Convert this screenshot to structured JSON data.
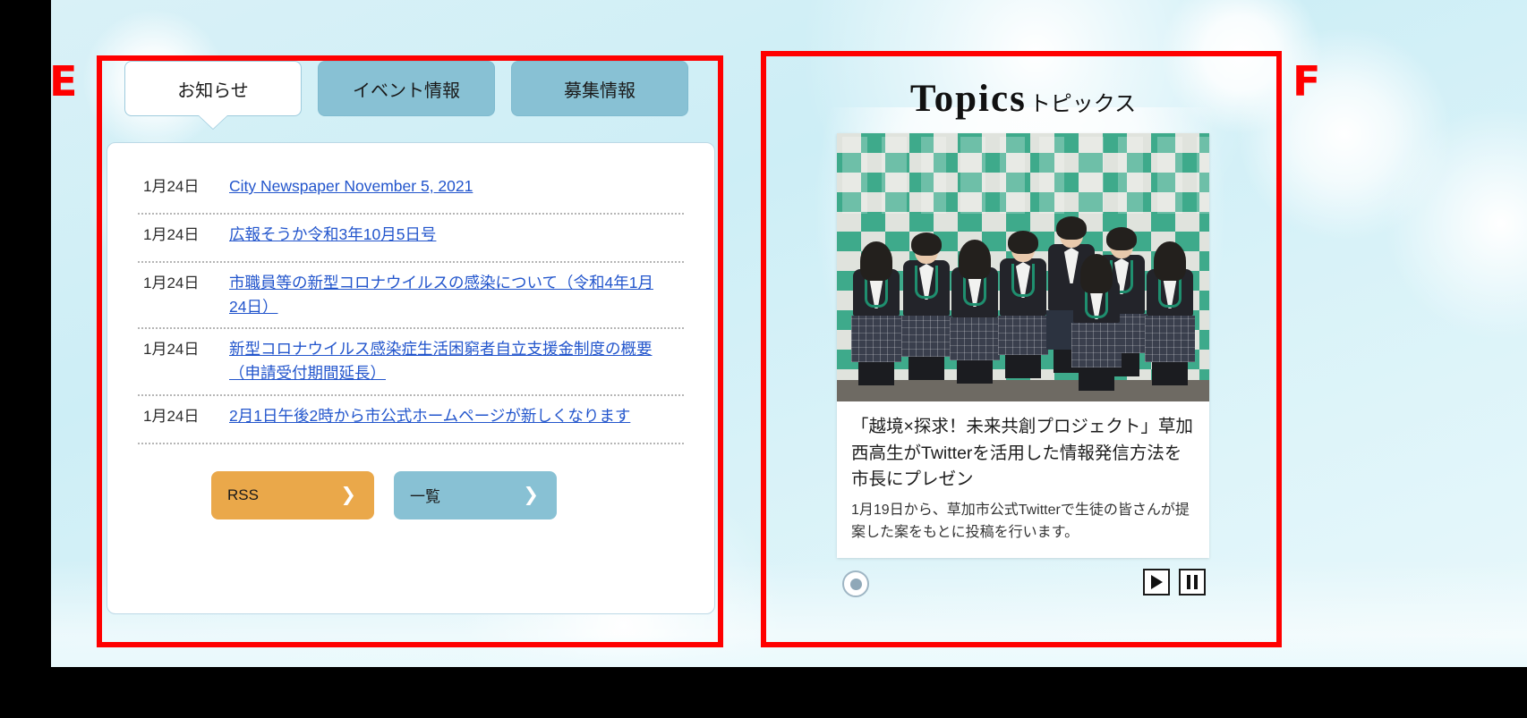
{
  "annotations": [
    {
      "label": "E"
    },
    {
      "label": "F"
    }
  ],
  "news_panel": {
    "tabs": [
      {
        "label": "お知らせ",
        "state": "active"
      },
      {
        "label": "イベント情報",
        "state": "inactive"
      },
      {
        "label": "募集情報",
        "state": "inactive"
      }
    ],
    "items": [
      {
        "date": "1月24日",
        "title": "City Newspaper November 5, 2021"
      },
      {
        "date": "1月24日",
        "title": "広報そうか令和3年10月5日号"
      },
      {
        "date": "1月24日",
        "title": "市職員等の新型コロナウイルスの感染について（令和4年1月24日）"
      },
      {
        "date": "1月24日",
        "title": "新型コロナウイルス感染症生活困窮者自立支援金制度の概要（申請受付期間延長）"
      },
      {
        "date": "1月24日",
        "title": "2月1日午後2時から市公式ホームページが新しくなります"
      }
    ],
    "buttons": [
      {
        "label": "RSS",
        "chevron": "❯",
        "color": "#eaa84a"
      },
      {
        "label": "一覧",
        "chevron": "❯",
        "color": "#88c1d4"
      }
    ]
  },
  "topics_panel": {
    "title_en": "Topics",
    "title_jp": "トピックス",
    "card": {
      "headline": "「越境×探求！未来共創プロジェクト」草加西高生がTwitterを活用した情報発信方法を市長にプレゼン",
      "description": "1月19日から、草加市公式Twitterで生徒の皆さんが提案した案をもとに投稿を行います。",
      "image_alt": "集合写真"
    },
    "controls": {
      "indicator": "slide-indicator",
      "play": "▶",
      "pause": "❚❚"
    }
  },
  "colors": {
    "tab_active_bg": "#ffffff",
    "tab_inactive_bg": "#88c1d4",
    "rss_button": "#eaa84a",
    "list_button": "#88c1d4",
    "link": "#2255cc",
    "annotation": "#ff0000",
    "page_bg": "#d3eff7"
  }
}
